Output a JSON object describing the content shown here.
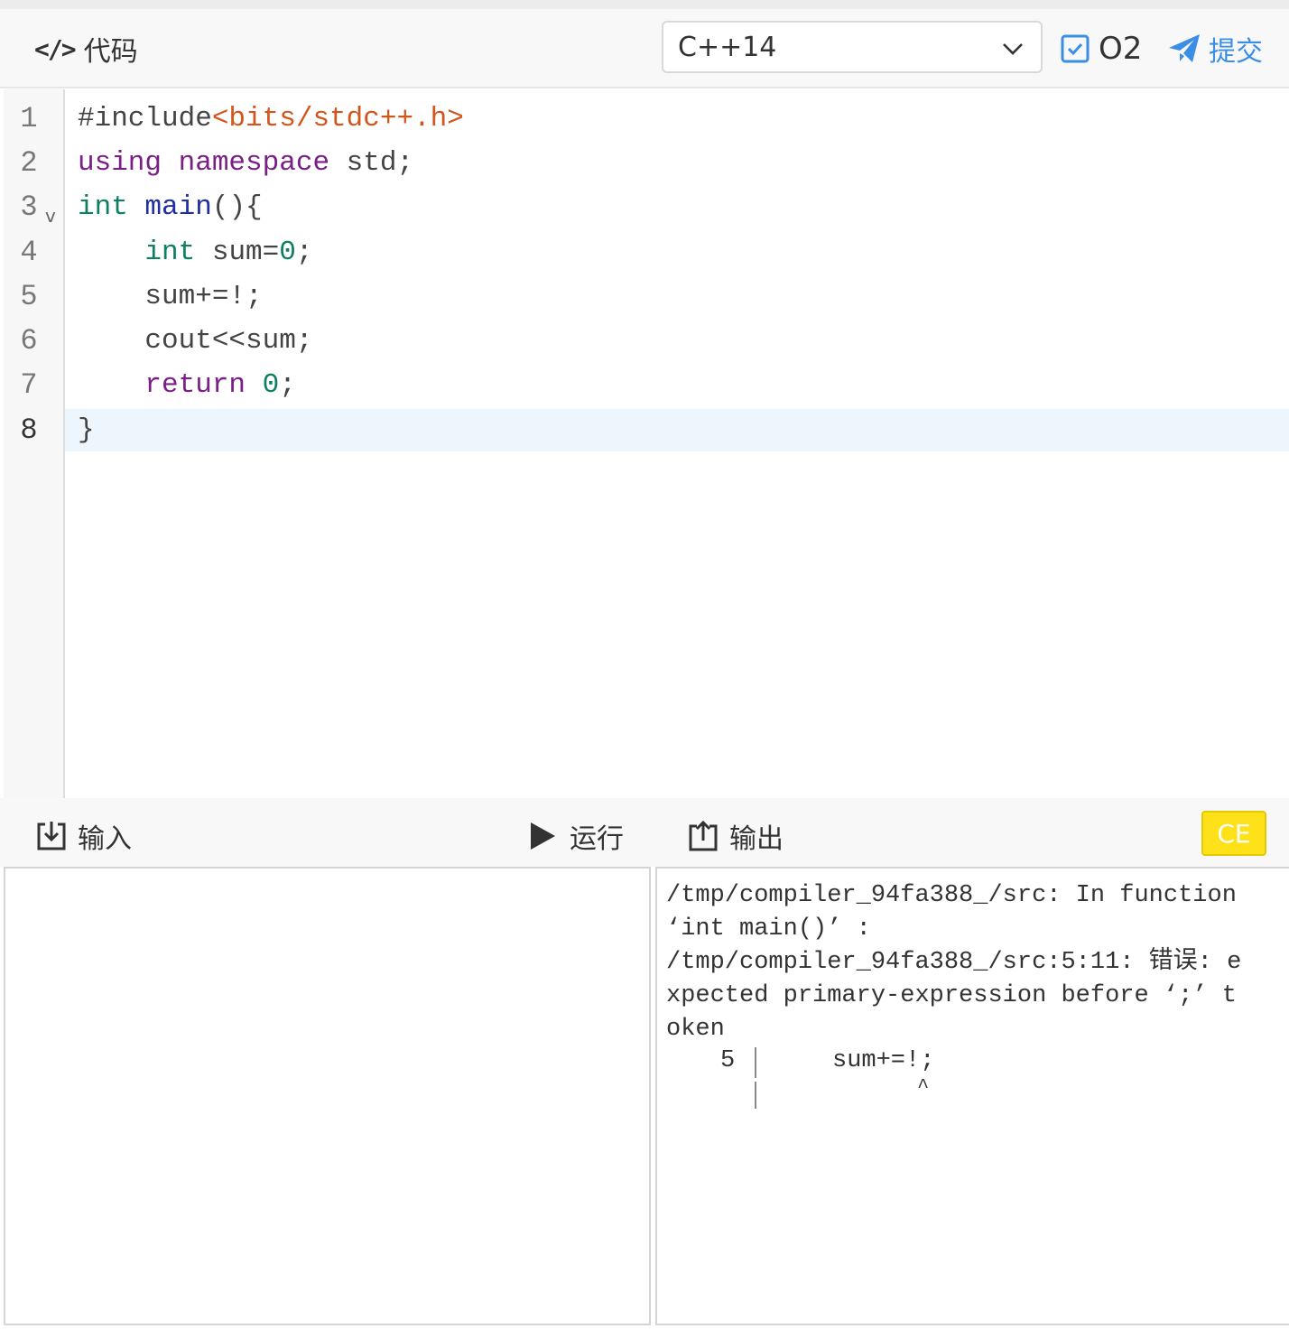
{
  "header": {
    "title_icon": "</>",
    "title": "代码",
    "language": "C++14",
    "o2_label": "O2",
    "o2_checked": true,
    "submit_label": "提交",
    "colors": {
      "accent": "#3a8ee6"
    }
  },
  "editor": {
    "line_numbers": [
      "1",
      "2",
      "3",
      "4",
      "5",
      "6",
      "7",
      "8"
    ],
    "fold_marker": "v",
    "active_line": 8
  },
  "toolbar": {
    "input_label": "输入",
    "run_label": "运行",
    "output_label": "输出",
    "status_badge": "CE",
    "status_color": "#ffe11a"
  },
  "output": {
    "message": "/tmp/compiler_94fa388_/src: In function ‘int main()’ :\n/tmp/compiler_94fa388_/src:5:11: 错误: expected primary-expression before ‘;’ token",
    "snippet_line_no": "5",
    "snippet_code": "sum+=!;",
    "snippet_caret": "^"
  }
}
